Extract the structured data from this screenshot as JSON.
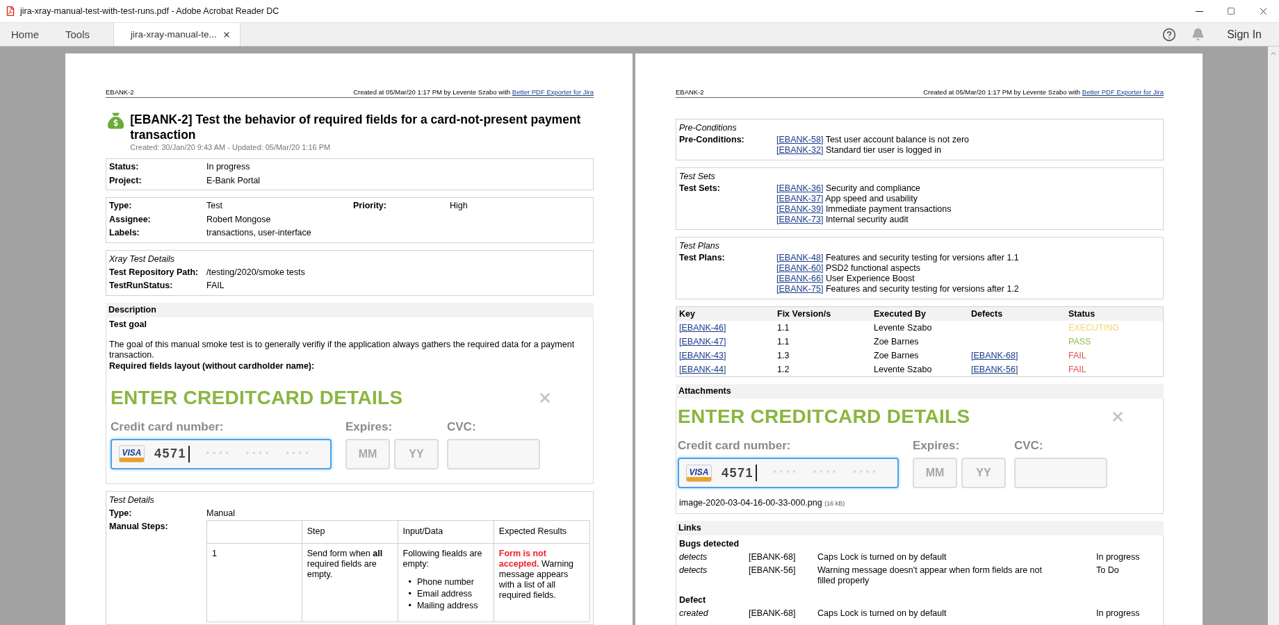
{
  "window": {
    "title": "jira-xray-manual-test-with-test-runs.pdf - Adobe Acrobat Reader DC"
  },
  "tabs": [
    {
      "label": "Home",
      "kind": "nav",
      "selected": false
    },
    {
      "label": "Tools",
      "kind": "nav",
      "selected": false
    },
    {
      "label": "jira-xray-manual-te...",
      "kind": "document",
      "selected": true
    }
  ],
  "sign_in": "Sign In",
  "left_page": {
    "header": {
      "key": "EBANK-2",
      "created": "Created at 05/Mar/20 1:17 PM by Levente Szabo with",
      "link": "Better PDF Exporter for Jira"
    },
    "issue": {
      "title": "[EBANK-2] Test the behavior of required fields for a card-not-present payment transaction",
      "meta": "Created: 30/Jan/20 9:43 AM - Updated: 05/Mar/20 1:16 PM"
    },
    "field_boxes": [
      {
        "rows": [
          {
            "label": "Status:",
            "value": "In progress"
          },
          {
            "label": "Project:",
            "value": "E-Bank Portal"
          }
        ]
      },
      {
        "rows": [
          {
            "label": "Type:",
            "value": "Test",
            "label_2": "Priority:",
            "value_2": "High"
          },
          {
            "label": "Assignee:",
            "value": "Robert Mongose"
          },
          {
            "label": "Labels:",
            "value": "transactions, user-interface"
          }
        ]
      },
      {
        "heading": "Xray Test Details",
        "rows": [
          {
            "label": "Test Repository Path:",
            "value": "/testing/2020/smoke tests"
          },
          {
            "label": "TestRunStatus:",
            "value": "FAIL"
          }
        ]
      }
    ],
    "description": {
      "heading": "Description",
      "subheading": "Test goal",
      "text": "The goal of this manual smoke test is to generally verifiy if the application always gathers the required data for a payment transaction.",
      "layout_label": "Required fields layout (without cardholder name):",
      "card_form": {
        "title": "ENTER CREDITCARD DETAILS",
        "number_label": "Credit card number:",
        "card_brand": "VISA",
        "number": "4571",
        "mask": [
          "* * * *",
          "* * * *",
          "* * * *"
        ],
        "expires_label": "Expires:",
        "month_placeholder": "MM",
        "year_placeholder": "YY",
        "cvc_label": "CVC:"
      }
    },
    "test_details": {
      "heading": "Test Details",
      "type_label": "Type:",
      "type": "Manual",
      "steps_label": "Manual Steps:",
      "columns": [
        "Step",
        "Input/Data",
        "Expected Results"
      ],
      "steps": [
        {
          "number": "1",
          "step": "Send form when **all** required fields are empty.",
          "input": "Following fiealds are empty:",
          "input_marker": "•",
          "input_items": [
            "Phone number",
            "Email address",
            "Mailing address"
          ],
          "expected": "**Form is not accepted.** Warning message appears with a list of all required fields."
        }
      ]
    }
  },
  "right_page": {
    "header": {
      "key": "EBANK-2",
      "created": "Created at 05/Mar/20 1:17 PM by Levente Szabo with",
      "link": "Better PDF Exporter for Jira"
    },
    "link_sections": [
      {
        "heading": "Pre-Conditions",
        "label": "Pre-Conditions:",
        "items": [
          {
            "key": "[EBANK-58]",
            "text": "Test user account balance is not zero"
          },
          {
            "key": "[EBANK-32]",
            "text": "Standard tier user is logged in"
          }
        ]
      },
      {
        "heading": "Test Sets",
        "label": "Test Sets:",
        "items": [
          {
            "key": "[EBANK-36]",
            "text": "Security and compliance"
          },
          {
            "key": "[EBANK-37]",
            "text": "App speed and usability"
          },
          {
            "key": "[EBANK-39]",
            "text": "Immediate payment transactions"
          },
          {
            "key": "[EBANK-73]",
            "text": "Internal security audit"
          }
        ]
      },
      {
        "heading": "Test Plans",
        "label": "Test Plans:",
        "items": [
          {
            "key": "[EBANK-48]",
            "text": "Features and security testing for versions after 1.1"
          },
          {
            "key": "[EBANK-60]",
            "text": "PSD2 functional aspects"
          },
          {
            "key": "[EBANK-66]",
            "text": "User Experience Boost"
          },
          {
            "key": "[EBANK-75]",
            "text": "Features and security testing for versions after 1.2"
          }
        ]
      }
    ],
    "test_runs": {
      "columns": [
        "Key",
        "Fix Version/s",
        "Executed By",
        "Defects",
        "Status"
      ],
      "rows": [
        {
          "key": "[EBANK-46]",
          "version": "1.1",
          "executed_by": "Levente Szabo",
          "status": "EXECUTING",
          "color": "#f2d66e"
        },
        {
          "key": "[EBANK-47]",
          "version": "1.1",
          "executed_by": "Zoe Barnes",
          "status": "PASS",
          "color": "#8fbf4f"
        },
        {
          "key": "[EBANK-43]",
          "version": "1.3",
          "executed_by": "Zoe Barnes",
          "defect": "[EBANK-68]",
          "status": "FAIL",
          "color": "#e0524c"
        },
        {
          "key": "[EBANK-44]",
          "version": "1.2",
          "executed_by": "Levente Szabo",
          "defect": "[EBANK-56]",
          "status": "FAIL",
          "color": "#e0524c"
        }
      ]
    },
    "attachments": {
      "heading": "Attachments",
      "card_form": {
        "title": "ENTER CREDITCARD DETAILS",
        "number_label": "Credit card number:",
        "card_brand": "VISA",
        "number": "4571",
        "mask": [
          "* * * *",
          "* * * *",
          "* * * *"
        ],
        "expires_label": "Expires:",
        "month_placeholder": "MM",
        "year_placeholder": "YY",
        "cvc_label": "CVC:"
      },
      "file": "image-2020-03-04-16-00-33-000.png",
      "size": "(16 kB)"
    },
    "links": {
      "heading": "Links",
      "groups": [
        {
          "title": "Bugs detected",
          "rows": [
            {
              "relation": "detects",
              "key": "[EBANK-68]",
              "summary": "Caps Lock is turned on by default",
              "status": "In progress"
            },
            {
              "relation": "detects",
              "key": "[EBANK-56]",
              "summary": "Warning message doesn't appear when form fields are not filled properly",
              "status": "To Do"
            }
          ]
        },
        {
          "title": "Defect",
          "rows": [
            {
              "relation": "created",
              "key": "[EBANK-68]",
              "summary": "Caps Lock is turned on by default",
              "status": "In progress"
            }
          ]
        }
      ]
    }
  }
}
